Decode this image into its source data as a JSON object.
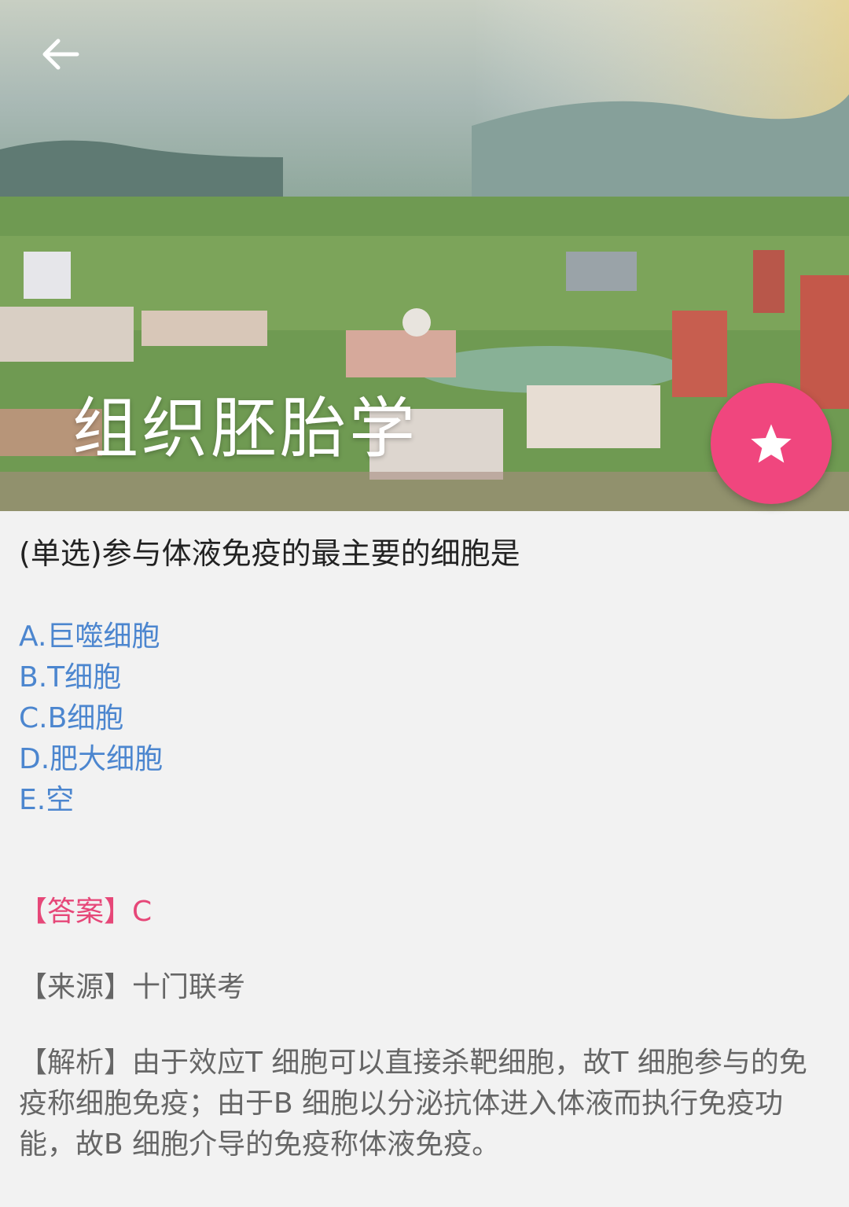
{
  "header": {
    "title": "组织胚胎学",
    "back_icon": "arrow-left-icon",
    "favorite_icon": "star-icon",
    "favorite_color": "#f0467e"
  },
  "question": {
    "text": "(单选)参与体液免疫的最主要的细胞是",
    "options": [
      "A.巨噬细胞",
      "B.T细胞",
      "C.B细胞",
      "D.肥大细胞",
      "E.空"
    ]
  },
  "answer": "【答案】C",
  "source": "【来源】十门联考",
  "analysis": "【解析】由于效应T 细胞可以直接杀靶细胞，故T 细胞参与的免疫称细胞免疫；由于B 细胞以分泌抗体进入体液而执行免疫功能，故B 细胞介导的免疫称体液免疫。",
  "colors": {
    "option_text": "#4c86cf",
    "answer_text": "#e64778",
    "muted_text": "#666666"
  }
}
